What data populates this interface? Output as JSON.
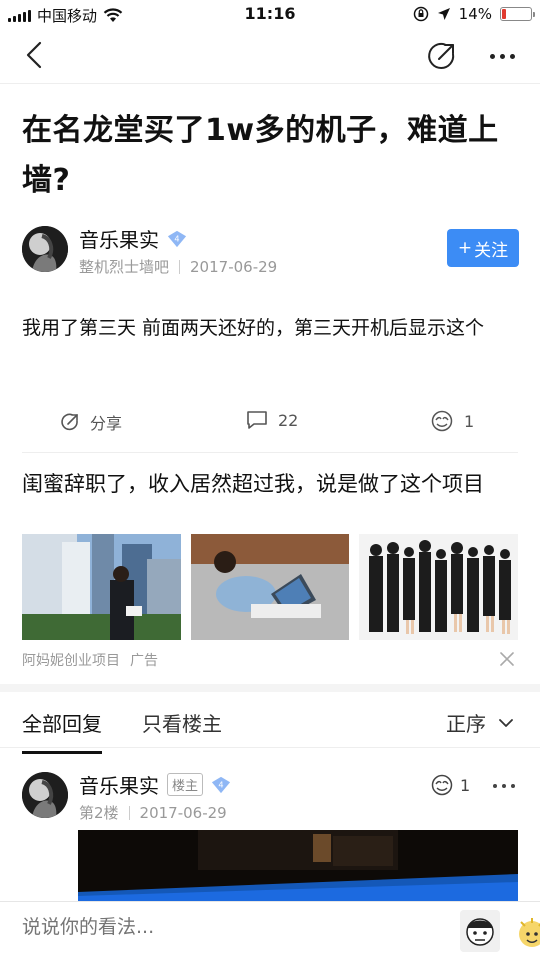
{
  "status_bar": {
    "carrier": "中国移动",
    "time": "11:16",
    "battery_percent": "14%",
    "battery_level": 0.14
  },
  "nav": {
    "back_icon": "chevron-left-icon",
    "share_icon": "share-icon",
    "more_icon": "more-icon"
  },
  "post": {
    "title": "在名龙堂买了1w多的机子，难道上墙?",
    "author": {
      "name": "音乐果实",
      "level": "4",
      "forum": "整机烈士墙吧",
      "date": "2017-06-29"
    },
    "follow_label": "关注",
    "body": "我用了第三天 前面两天还好的，第三天开机后显示这个",
    "actions": {
      "share_label": "分享",
      "comment_count": "22",
      "like_count": "1"
    }
  },
  "ad": {
    "title": "闺蜜辞职了，收入居然超过我，说是做了这个项目",
    "source": "阿妈妮创业项目",
    "tag": "广告"
  },
  "tabs": {
    "all_replies": "全部回复",
    "only_op": "只看楼主",
    "sort": "正序"
  },
  "reply": {
    "name": "音乐果实",
    "op_badge": "楼主",
    "level": "4",
    "floor": "第2楼",
    "date": "2017-06-29",
    "like_count": "1"
  },
  "bottom_bar": {
    "placeholder": "说说你的看法..."
  },
  "colors": {
    "accent": "#3c8cf5",
    "battery_low": "#e03a2f"
  }
}
